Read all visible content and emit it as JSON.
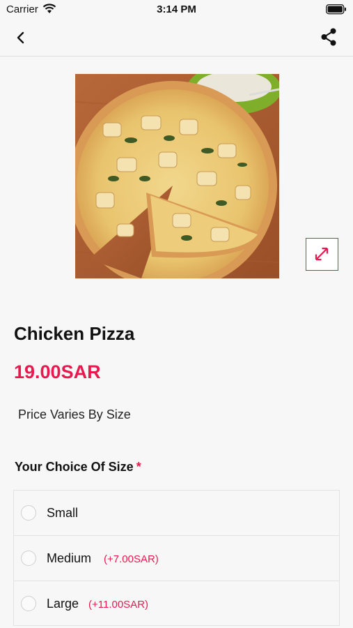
{
  "status_bar": {
    "carrier": "Carrier",
    "time": "3:14 PM"
  },
  "nav": {
    "back_icon": "chevron-left-icon",
    "share_icon": "share-icon"
  },
  "product": {
    "image_alt": "pizza-photo",
    "name": "Chicken Pizza",
    "price": "19.00SAR",
    "price_note": "Price Varies By Size",
    "expand_icon": "expand-icon"
  },
  "size_section": {
    "title": "Your Choice Of Size",
    "required_mark": "*",
    "options": [
      {
        "label": "Small",
        "extra": ""
      },
      {
        "label": "Medium",
        "extra": "(+7.00SAR)"
      },
      {
        "label": "Large",
        "extra": "(+11.00SAR)"
      }
    ]
  },
  "colors": {
    "accent": "#e8194e",
    "background": "#f7f7f7"
  }
}
